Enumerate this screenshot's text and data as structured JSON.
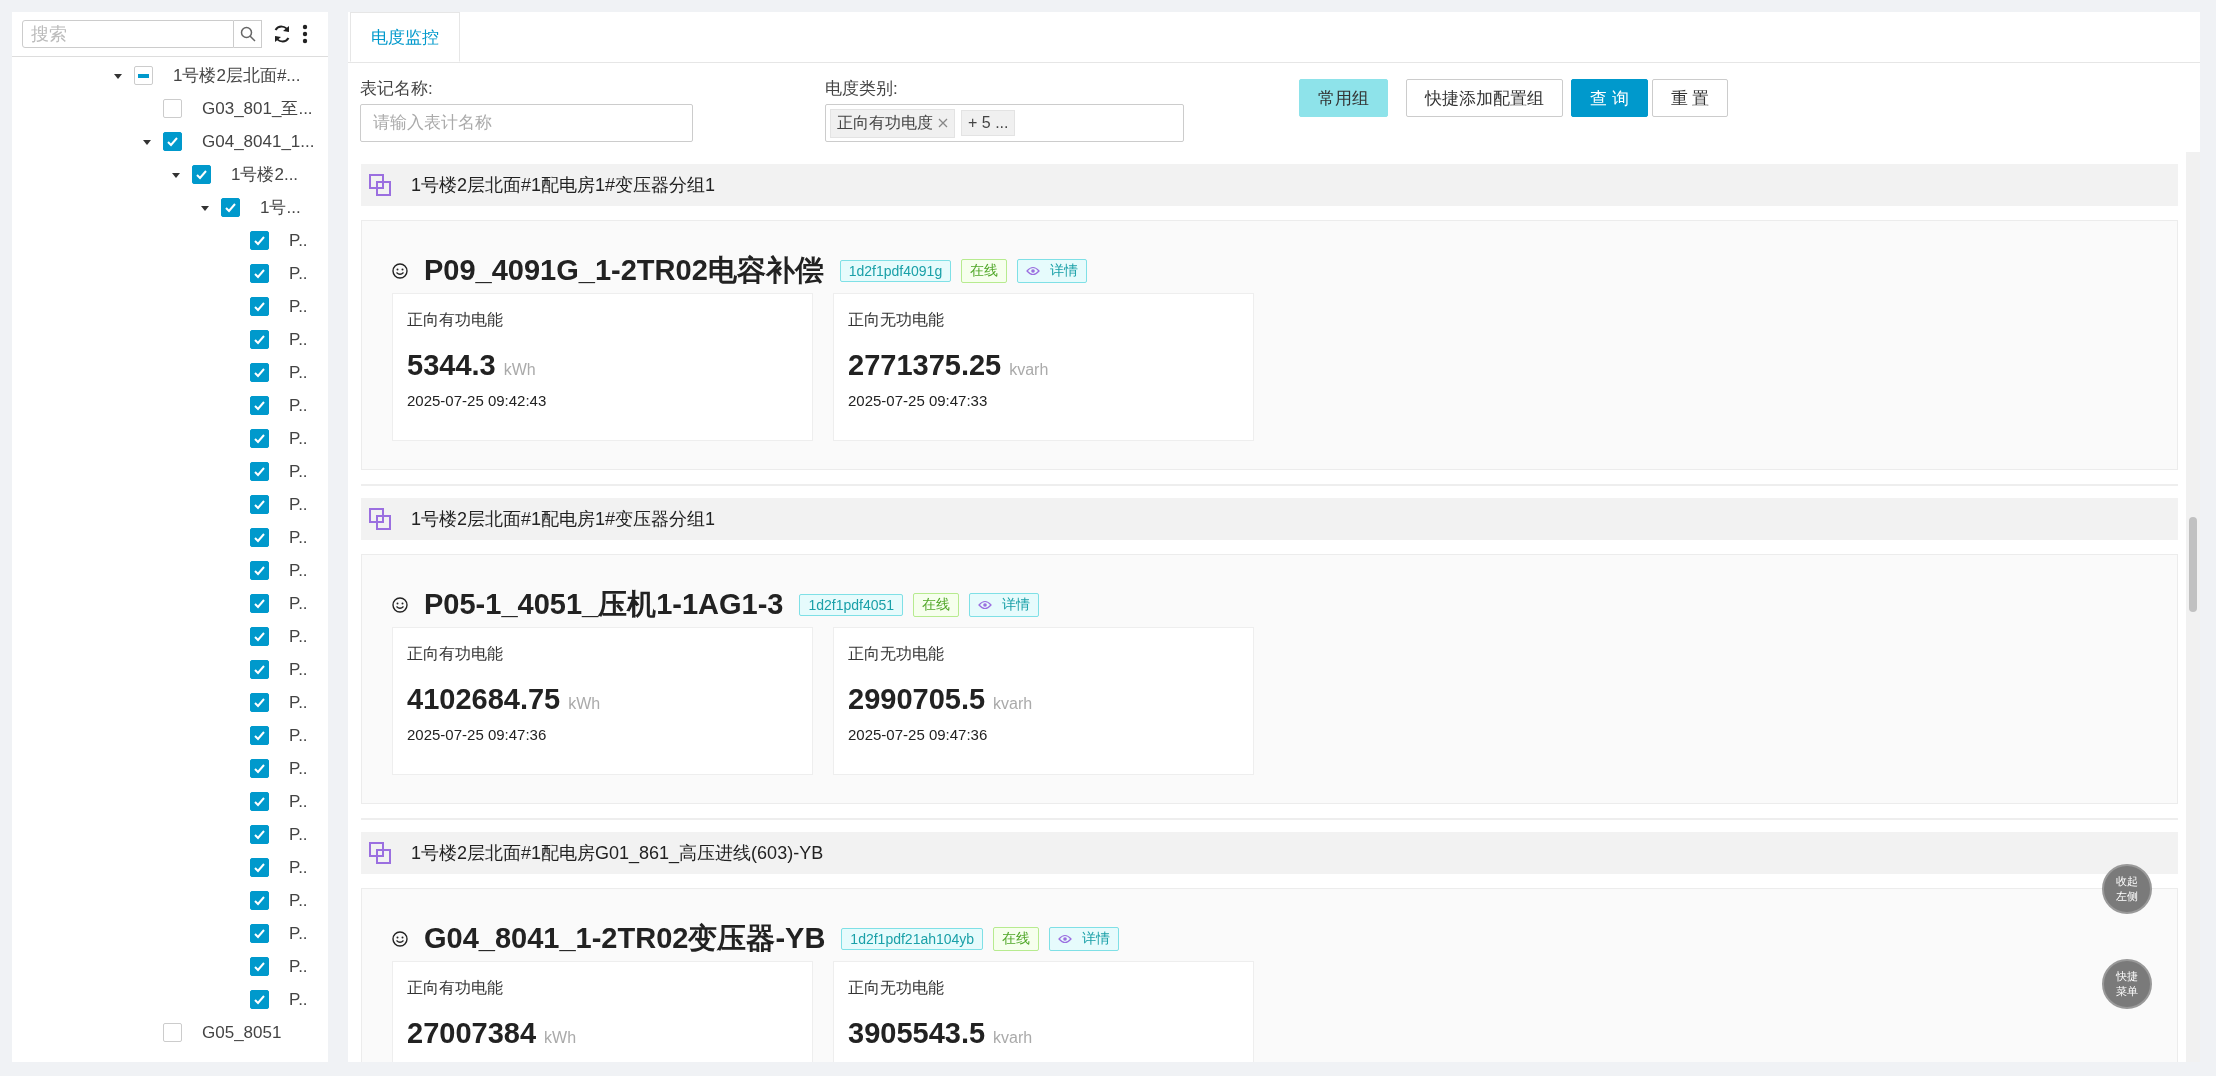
{
  "sidebar": {
    "search": {
      "placeholder": "搜索"
    },
    "tree": [
      {
        "label": "1号楼2层北面#...",
        "checked": false,
        "partial": true,
        "expanded": true,
        "children": [
          {
            "label": "G03_801_至...",
            "checked": false
          },
          {
            "label": "G04_8041_1...",
            "checked": true,
            "expanded": true,
            "children": [
              {
                "label": "1号楼2...",
                "checked": true,
                "expanded": true,
                "children": [
                  {
                    "label": "1号...",
                    "checked": true,
                    "expanded": true,
                    "children": [
                      {
                        "label": "P..",
                        "checked": true
                      },
                      {
                        "label": "P..",
                        "checked": true
                      },
                      {
                        "label": "P..",
                        "checked": true
                      },
                      {
                        "label": "P..",
                        "checked": true
                      },
                      {
                        "label": "P..",
                        "checked": true
                      },
                      {
                        "label": "P..",
                        "checked": true
                      },
                      {
                        "label": "P..",
                        "checked": true
                      },
                      {
                        "label": "P..",
                        "checked": true
                      },
                      {
                        "label": "P..",
                        "checked": true
                      },
                      {
                        "label": "P..",
                        "checked": true
                      },
                      {
                        "label": "P..",
                        "checked": true
                      },
                      {
                        "label": "P..",
                        "checked": true
                      },
                      {
                        "label": "P..",
                        "checked": true
                      },
                      {
                        "label": "P..",
                        "checked": true
                      },
                      {
                        "label": "P..",
                        "checked": true
                      },
                      {
                        "label": "P..",
                        "checked": true
                      },
                      {
                        "label": "P..",
                        "checked": true
                      },
                      {
                        "label": "P..",
                        "checked": true
                      },
                      {
                        "label": "P..",
                        "checked": true
                      },
                      {
                        "label": "P..",
                        "checked": true
                      },
                      {
                        "label": "P..",
                        "checked": true
                      },
                      {
                        "label": "P..",
                        "checked": true
                      },
                      {
                        "label": "P..",
                        "checked": true
                      },
                      {
                        "label": "P..",
                        "checked": true
                      }
                    ]
                  }
                ]
              }
            ]
          },
          {
            "label": "G05_8051",
            "checked": false
          }
        ]
      }
    ]
  },
  "tabs": [
    {
      "label": "电度监控",
      "selected": true
    }
  ],
  "filters": [
    {
      "kind": "input",
      "label": "表记名称:",
      "placeholder": "请输入表计名称"
    },
    {
      "kind": "select",
      "label": "电度类别:",
      "tags": [
        "正向有功电度"
      ],
      "more": "+ 5 ..."
    }
  ],
  "buttons": [
    {
      "label": "常用组",
      "kind": "accent"
    },
    {
      "label": "快捷添加配置组",
      "kind": "default"
    },
    {
      "label": "查 询",
      "kind": "primary"
    },
    {
      "label": "重 置",
      "kind": "default"
    }
  ],
  "groups": [
    {
      "title": "1号楼2层北面#1配电房1#变压器分组1",
      "meter": {
        "name": "P09_4091G_1-2TR02电容补偿",
        "code": "1d2f1pdf4091g",
        "status": "在线",
        "detail": "详情",
        "readings": [
          {
            "label": "正向有功电能",
            "value": "5344.3",
            "unit": "kWh",
            "time": "2025-07-25 09:42:43"
          },
          {
            "label": "正向无功电能",
            "value": "2771375.25",
            "unit": "kvarh",
            "time": "2025-07-25 09:47:33"
          }
        ]
      }
    },
    {
      "title": "1号楼2层北面#1配电房1#变压器分组1",
      "meter": {
        "name": "P05-1_4051_压机1-1AG1-3",
        "code": "1d2f1pdf4051",
        "status": "在线",
        "detail": "详情",
        "readings": [
          {
            "label": "正向有功电能",
            "value": "4102684.75",
            "unit": "kWh",
            "time": "2025-07-25 09:47:36"
          },
          {
            "label": "正向无功电能",
            "value": "2990705.5",
            "unit": "kvarh",
            "time": "2025-07-25 09:47:36"
          }
        ]
      }
    },
    {
      "title": "1号楼2层北面#1配电房G01_861_高压进线(603)-YB",
      "meter": {
        "name": "G04_8041_1-2TR02变压器-YB",
        "code": "1d2f1pdf21ah104yb",
        "status": "在线",
        "detail": "详情",
        "readings": [
          {
            "label": "正向有功电能",
            "value": "27007384",
            "unit": "kWh"
          },
          {
            "label": "正向无功电能",
            "value": "3905543.5",
            "unit": "kvarh"
          }
        ]
      }
    }
  ],
  "float_buttons": [
    "收起左侧",
    "快捷菜单"
  ]
}
